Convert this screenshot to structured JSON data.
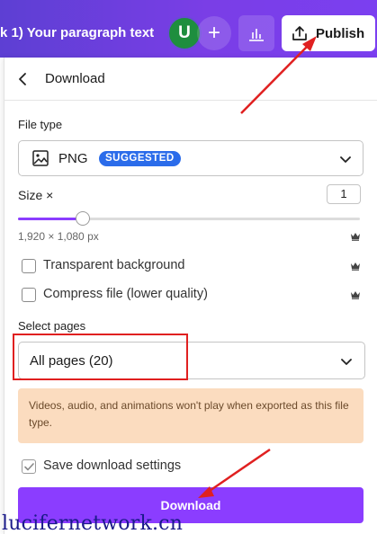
{
  "header": {
    "doc_title": "k 1) Your paragraph text",
    "avatar_letter": "U",
    "plus_symbol": "+",
    "publish_label": "Publish"
  },
  "panel": {
    "title": "Download",
    "file_type_label": "File type",
    "file_type_value": "PNG",
    "suggested_badge": "SUGGESTED",
    "size_label": "Size ×",
    "size_value": "1",
    "size_slider_fraction": 0.19,
    "dimensions": "1,920 × 1,080 px",
    "transparent_bg_label": "Transparent background",
    "compress_label": "Compress file (lower quality)",
    "select_pages_label": "Select pages",
    "pages_value": "All pages (20)",
    "warning_text": "Videos, audio, and animations won't play when exported as this file type.",
    "save_settings_label": "Save download settings",
    "save_settings_checked": true,
    "download_label": "Download"
  },
  "watermark": "lucifernetwork.cn",
  "colors": {
    "brand_purple": "#8b3dff",
    "header_gradient_start": "#5d3fd3",
    "badge_blue": "#2b6cea",
    "warning_bg": "#fbdcbf",
    "annotation_red": "#e02020",
    "avatar_green": "#1e8e3e"
  },
  "icons": [
    "back-chevron-icon",
    "image-icon",
    "chevron-down-icon",
    "crown-icon",
    "upload-icon",
    "bar-chart-icon",
    "plus-icon"
  ]
}
